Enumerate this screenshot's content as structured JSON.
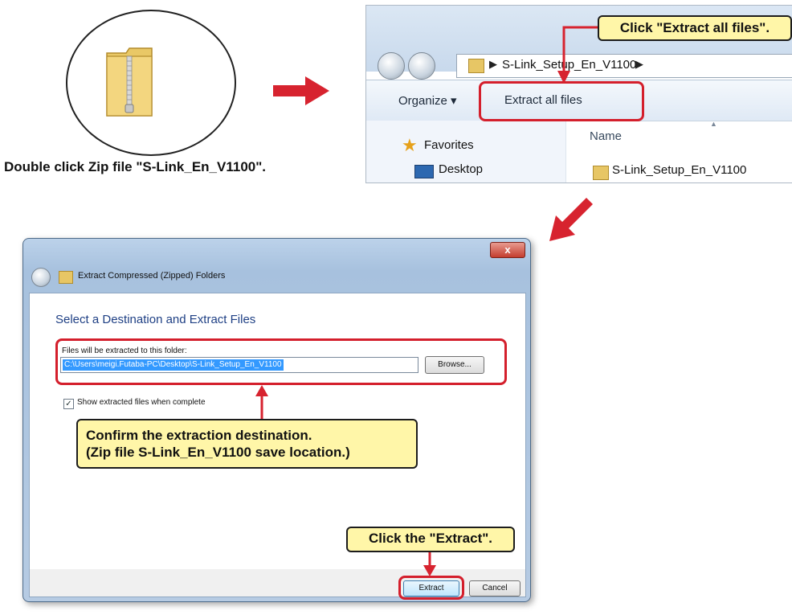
{
  "step1": {
    "icon": "zip-folder-icon",
    "caption": "Double click Zip file \"S-Link_En_V1100\"."
  },
  "explorer": {
    "address": {
      "icon": "folder-icon",
      "path_item": "S-Link_Setup_En_V1100"
    },
    "toolbar": {
      "organize_label": "Organize",
      "extract_all_label": "Extract all files"
    },
    "nav": {
      "favorites_label": "Favorites",
      "desktop_label": "Desktop"
    },
    "list": {
      "column_name": "Name",
      "items": [
        "S-Link_Setup_En_V1100"
      ]
    },
    "callout": "Click \"Extract all files\"."
  },
  "dialog": {
    "close_glyph": "x",
    "title": "Extract Compressed (Zipped) Folders",
    "heading": "Select a Destination and Extract Files",
    "dest_label": "Files will be extracted to this folder:",
    "dest_value": "C:\\Users\\meigi.Futaba-PC\\Desktop\\S-Link_Setup_En_V1100",
    "browse_label": "Browse...",
    "checkbox_label": "Show extracted files when complete",
    "checkbox_checked": true,
    "extract_label": "Extract",
    "cancel_label": "Cancel"
  },
  "callouts": {
    "destination_line1": "Confirm the extraction destination.",
    "destination_line2": "(Zip file S-Link_En_V1100 save location.)",
    "extract": "Click the \"Extract\"."
  },
  "colors": {
    "highlight_red": "#d41f2c",
    "callout_yellow": "#fff6a8",
    "arrow_red": "#d7232f"
  }
}
